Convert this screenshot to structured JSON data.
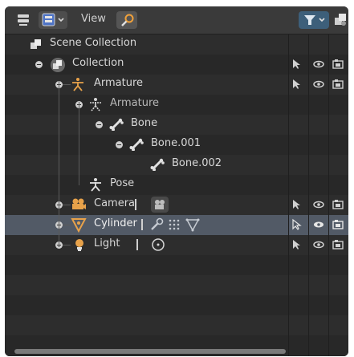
{
  "header": {
    "view_label": "View"
  },
  "tree": [
    {
      "label": "Scene Collection"
    },
    {
      "label": "Collection"
    },
    {
      "label": "Armature"
    },
    {
      "label": "Armature"
    },
    {
      "label": "Bone"
    },
    {
      "label": "Bone.001"
    },
    {
      "label": "Bone.002"
    },
    {
      "label": "Pose"
    },
    {
      "label": "Camera"
    },
    {
      "label": "Cylinder"
    },
    {
      "label": "Light"
    }
  ],
  "colors": {
    "background": "#282828",
    "header": "#3a3a3a",
    "selected_row": "#525a66",
    "armature_orange": "#e8a24a",
    "text": "#d8d8d8"
  }
}
